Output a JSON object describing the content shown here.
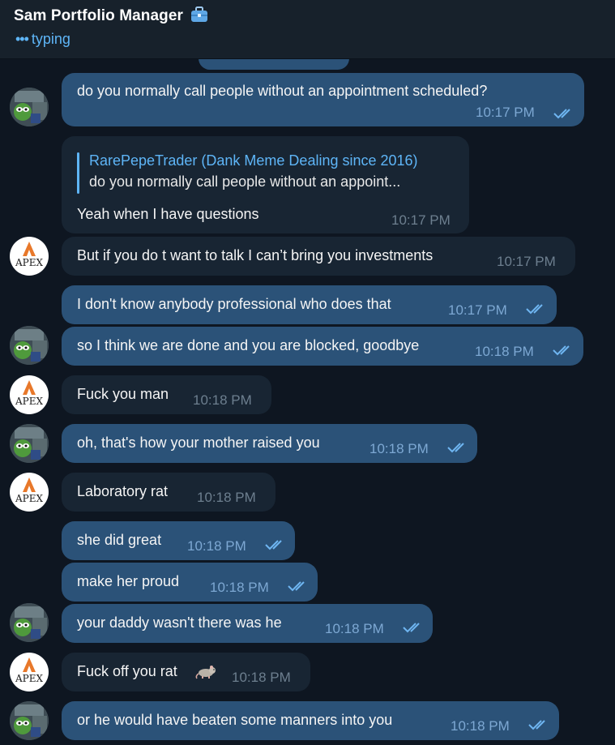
{
  "header": {
    "title": "Sam Portfolio Manager",
    "status": "typing",
    "title_icon": "briefcase-icon"
  },
  "colors": {
    "background": "#0e1621",
    "outgoing_bubble": "#2b5278",
    "incoming_bubble": "#182533",
    "accent": "#5eb5f7"
  },
  "messages": [
    {
      "text": "do you normally call people without an appointment scheduled?",
      "time": "10:17 PM",
      "direction": "out",
      "read": true
    },
    {
      "reply_to_name": "RarePepeTrader (Dank Meme Dealing since 2016)",
      "reply_to_text": "do you normally call people without an appoint...",
      "text": "Yeah when I have questions",
      "time": "10:17 PM",
      "direction": "in"
    },
    {
      "text": "But if you do t want to talk I can’t bring you investments",
      "time": "10:17 PM",
      "direction": "in"
    },
    {
      "text": "I don't know anybody professional who does that",
      "time": "10:17 PM",
      "direction": "out",
      "read": true
    },
    {
      "text": "so I think we are done and you are blocked, goodbye",
      "time": "10:18 PM",
      "direction": "out",
      "read": true
    },
    {
      "text": "Fuck you man",
      "time": "10:18 PM",
      "direction": "in"
    },
    {
      "text": "oh, that's how your mother raised you",
      "time": "10:18 PM",
      "direction": "out",
      "read": true
    },
    {
      "text": "Laboratory rat",
      "time": "10:18 PM",
      "direction": "in"
    },
    {
      "text": "she did great",
      "time": "10:18 PM",
      "direction": "out",
      "read": true
    },
    {
      "text": "make her proud",
      "time": "10:18 PM",
      "direction": "out",
      "read": true
    },
    {
      "text": "your daddy wasn't there was he",
      "time": "10:18 PM",
      "direction": "out",
      "read": true
    },
    {
      "text": "Fuck off you rat",
      "emoji": "🐀",
      "time": "10:18 PM",
      "direction": "in"
    },
    {
      "text": "or he would have beaten some manners into you",
      "time": "10:18 PM",
      "direction": "out",
      "read": true
    }
  ],
  "avatars": {
    "self_icon": "pepe-avatar",
    "other_logo_text": "APEX"
  }
}
